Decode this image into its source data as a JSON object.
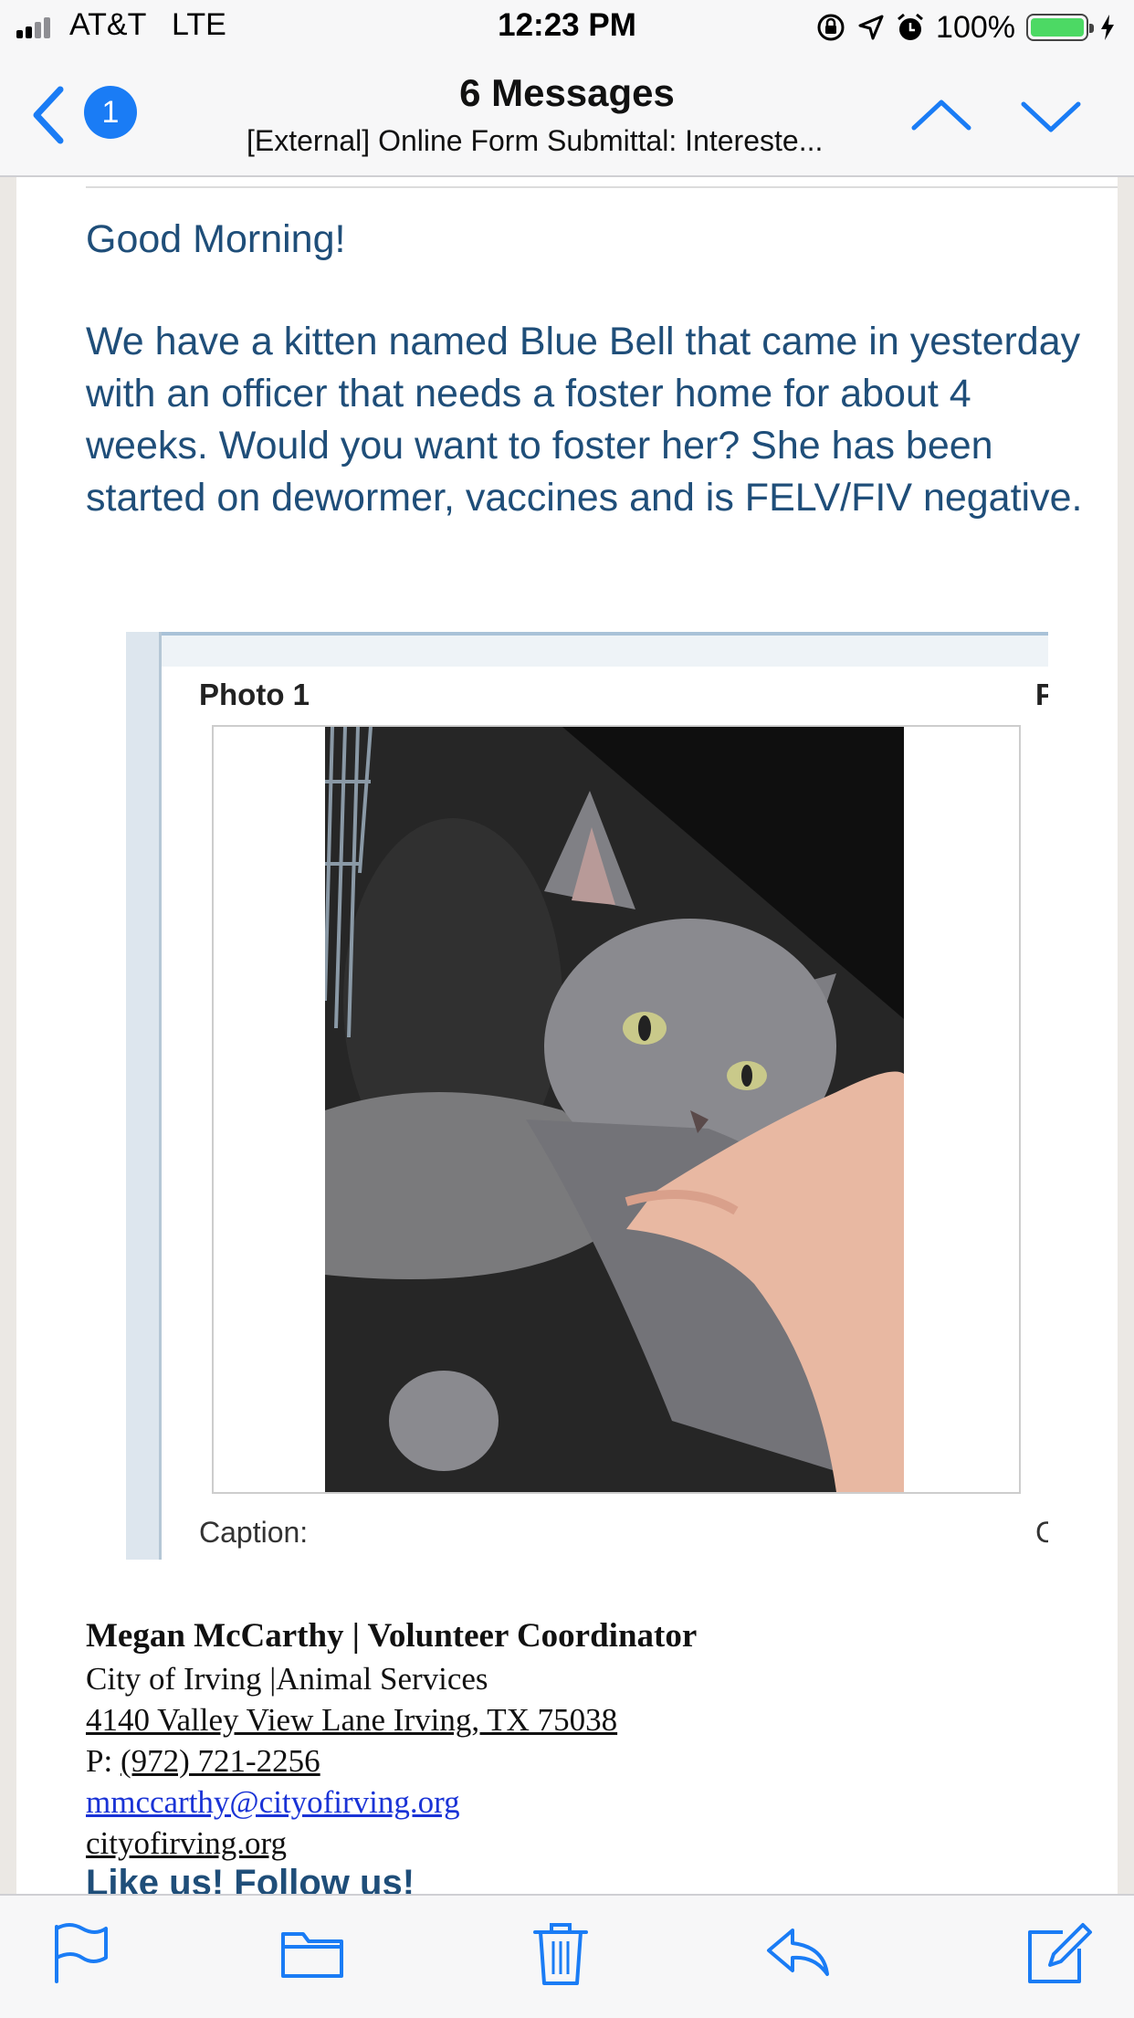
{
  "status_bar": {
    "carrier": "AT&T",
    "network": "LTE",
    "time": "12:23 PM",
    "battery_percent": "100%"
  },
  "nav": {
    "back_badge": "1",
    "title": "6 Messages",
    "subtitle": "[External] Online Form Submittal: Intereste..."
  },
  "email": {
    "greeting": "Good Morning!",
    "body": "We have a kitten named Blue Bell that came in yesterday with an officer that needs a foster home for about 4 weeks. Would you want to foster her? She has been started on dewormer, vaccines and is FELV/FIV negative.",
    "photo": {
      "label": "Photo 1",
      "label_next": "Ph",
      "caption_label": "Caption:",
      "caption_label_next": "Ca"
    },
    "signature": {
      "name": "Megan McCarthy | Volunteer Coordinator",
      "org": "City of Irving |Animal Services",
      "address": "4140 Valley View Lane Irving, TX 75038",
      "phone_prefix": "P: ",
      "phone": "(972) 721-2256",
      "email": "mmccarthy@cityofirving.org",
      "website": "cityofirving.org",
      "social": "Like us! Follow us!"
    }
  },
  "toolbar": {
    "icons": [
      "flag-icon",
      "folder-icon",
      "trash-icon",
      "reply-icon",
      "compose-icon"
    ]
  },
  "colors": {
    "accent": "#1a7cf5",
    "body_text": "#1f4e79",
    "link": "#1a33d6",
    "battery": "#4cd964"
  }
}
